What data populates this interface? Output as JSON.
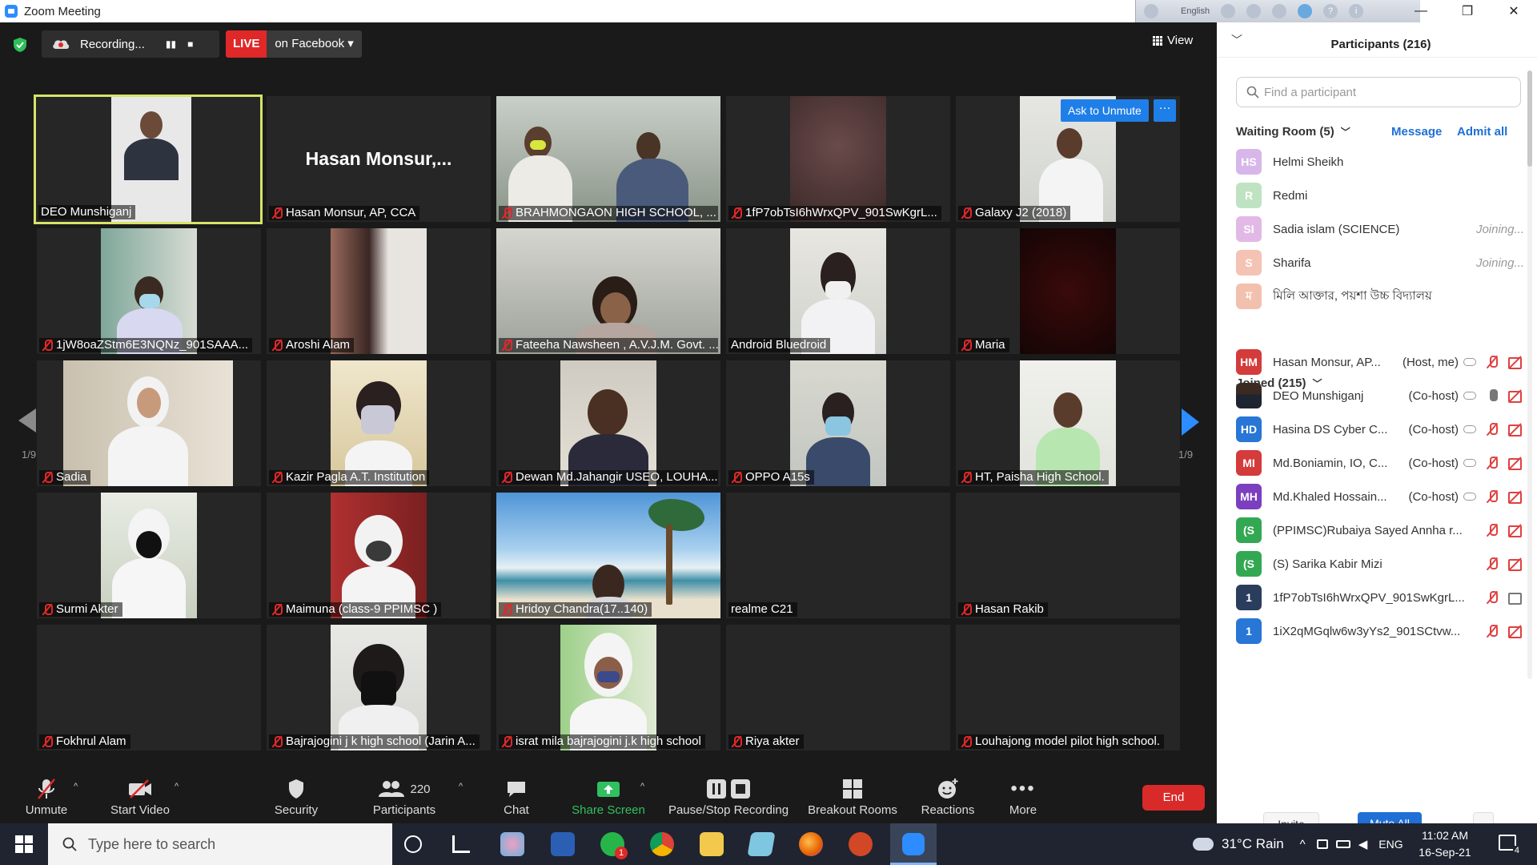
{
  "window": {
    "title": "Zoom Meeting",
    "minimize": "—",
    "maximize": "❐",
    "close": "✕"
  },
  "overlay": {
    "language": "English"
  },
  "topbar": {
    "recording_label": "Recording...",
    "pause_icon": "pause-icon",
    "stop_icon": "stop-icon",
    "live_label": "LIVE",
    "live_dest": "on Facebook ▾",
    "view_label": "View"
  },
  "ask_unmute": {
    "label": "Ask to Unmute",
    "more": "···"
  },
  "pager": {
    "left": "1/9",
    "right": "1/9"
  },
  "tiles": [
    {
      "name": "DEO Munshiganj",
      "muted": false
    },
    {
      "name": "Hasan Monsur, AP, CCA",
      "muted": true,
      "big": "Hasan  Monsur,..."
    },
    {
      "name": "BRAHMONGAON HIGH SCHOOL, ...",
      "muted": true
    },
    {
      "name": "1fP7obTsI6hWrxQPV_901SwKgrL...",
      "muted": true
    },
    {
      "name": "Galaxy J2 (2018)",
      "muted": true
    },
    {
      "name": "1jW8oaZStm6E3NQNz_901SAAA...",
      "muted": true
    },
    {
      "name": "Aroshi Alam",
      "muted": true
    },
    {
      "name": "Fateeha Nawsheen , A.V.J.M. Govt. ...",
      "muted": true
    },
    {
      "name": "Android Bluedroid",
      "muted": false
    },
    {
      "name": "Maria",
      "muted": true
    },
    {
      "name": "Sadia",
      "muted": true
    },
    {
      "name": "Kazir Pagla A.T. Institution",
      "muted": true
    },
    {
      "name": "Dewan Md.Jahangir USEO, LOUHA...",
      "muted": true
    },
    {
      "name": "OPPO A15s",
      "muted": true
    },
    {
      "name": "HT, Paisha High School.",
      "muted": true
    },
    {
      "name": "Surmi Akter",
      "muted": true
    },
    {
      "name": "Maimuna (class-9 PPIMSC )",
      "muted": true
    },
    {
      "name": "Hridoy Chandra(17..140)",
      "muted": true
    },
    {
      "name": "realme C21",
      "muted": false
    },
    {
      "name": "Hasan Rakib",
      "muted": true
    },
    {
      "name": "Fokhrul Alam",
      "muted": true
    },
    {
      "name": "Bajrajogini j k high school (Jarin A...",
      "muted": true
    },
    {
      "name": "israt mila bajrajogini j.k high school",
      "muted": true
    },
    {
      "name": "Riya akter",
      "muted": true
    },
    {
      "name": "Louhajong model pilot high school.",
      "muted": true
    }
  ],
  "toolbar": {
    "unmute": "Unmute",
    "start_video": "Start Video",
    "security": "Security",
    "participants": "Participants",
    "participants_count": "220",
    "chat": "Chat",
    "share_screen": "Share Screen",
    "pause_stop_recording": "Pause/Stop Recording",
    "breakout_rooms": "Breakout Rooms",
    "reactions": "Reactions",
    "more": "More",
    "end": "End"
  },
  "panel": {
    "title": "Participants (216)",
    "search_placeholder": "Find a participant",
    "waiting_room": "Waiting Room (5)",
    "message": "Message",
    "admit_all": "Admit all",
    "waiting": [
      {
        "initials": "HS",
        "name": "Helmi Sheikh",
        "status": "",
        "color": "#d7b7ea"
      },
      {
        "initials": "R",
        "name": "Redmi",
        "status": "",
        "color": "#bfe3c2"
      },
      {
        "initials": "SI",
        "name": "Sadia islam (SCIENCE)",
        "status": "Joining...",
        "color": "#e2b9e6"
      },
      {
        "initials": "S",
        "name": "Sharifa",
        "status": "Joining...",
        "color": "#f4c3b4"
      },
      {
        "initials": "ম",
        "name": "মিলি আক্তার, পয়শা উচ্চ বিদ্যালয়",
        "status": "",
        "color": "#f2c1ad"
      }
    ],
    "joined": "Joined (215)",
    "joined_list": [
      {
        "initials": "HM",
        "name": "Hasan Monsur, AP...",
        "role": "(Host, me)",
        "color": "#d43b3b",
        "cloud": true,
        "mic": "off",
        "cam": "off"
      },
      {
        "initials": "",
        "name": "DEO Munshiganj",
        "role": "(Co-host)",
        "color": "#6c6c6c",
        "cloud": true,
        "mic": "on",
        "cam": "off",
        "photo": true
      },
      {
        "initials": "HD",
        "name": "Hasina DS Cyber C...",
        "role": "(Co-host)",
        "color": "#2876d6",
        "cloud": true,
        "mic": "off",
        "cam": "off"
      },
      {
        "initials": "MI",
        "name": "Md.Boniamin, IO, C...",
        "role": "(Co-host)",
        "color": "#d43b3b",
        "cloud": true,
        "mic": "off",
        "cam": "off"
      },
      {
        "initials": "MH",
        "name": "Md.Khaled Hossain...",
        "role": "(Co-host)",
        "color": "#7b3fbf",
        "cloud": true,
        "mic": "off",
        "cam": "off"
      },
      {
        "initials": "(S",
        "name": "(PPIMSC)Rubaiya Sayed Annha r...",
        "role": "",
        "color": "#33a852",
        "cloud": false,
        "mic": "off",
        "cam": "off"
      },
      {
        "initials": "(S",
        "name": "(S) Sarika Kabir Mizi",
        "role": "",
        "color": "#33a852",
        "cloud": false,
        "mic": "off",
        "cam": "off"
      },
      {
        "initials": "1",
        "name": "1fP7obTsI6hWrxQPV_901SwKgrL...",
        "role": "",
        "color": "#2b3d5c",
        "cloud": false,
        "mic": "off",
        "cam": "on"
      },
      {
        "initials": "1",
        "name": "1iX2qMGqlw6w3yYs2_901SCtvw...",
        "role": "",
        "color": "#2876d6",
        "cloud": false,
        "mic": "off",
        "cam": "off"
      }
    ],
    "invite": "Invite",
    "mute_all": "Mute All",
    "more": "..."
  },
  "taskbar": {
    "search_placeholder": "Type here to search",
    "weather": "31°C  Rain",
    "lang": "ENG",
    "time": "11:02 AM",
    "date": "16-Sep-21",
    "notif": "4",
    "whatsapp_badge": "1"
  }
}
